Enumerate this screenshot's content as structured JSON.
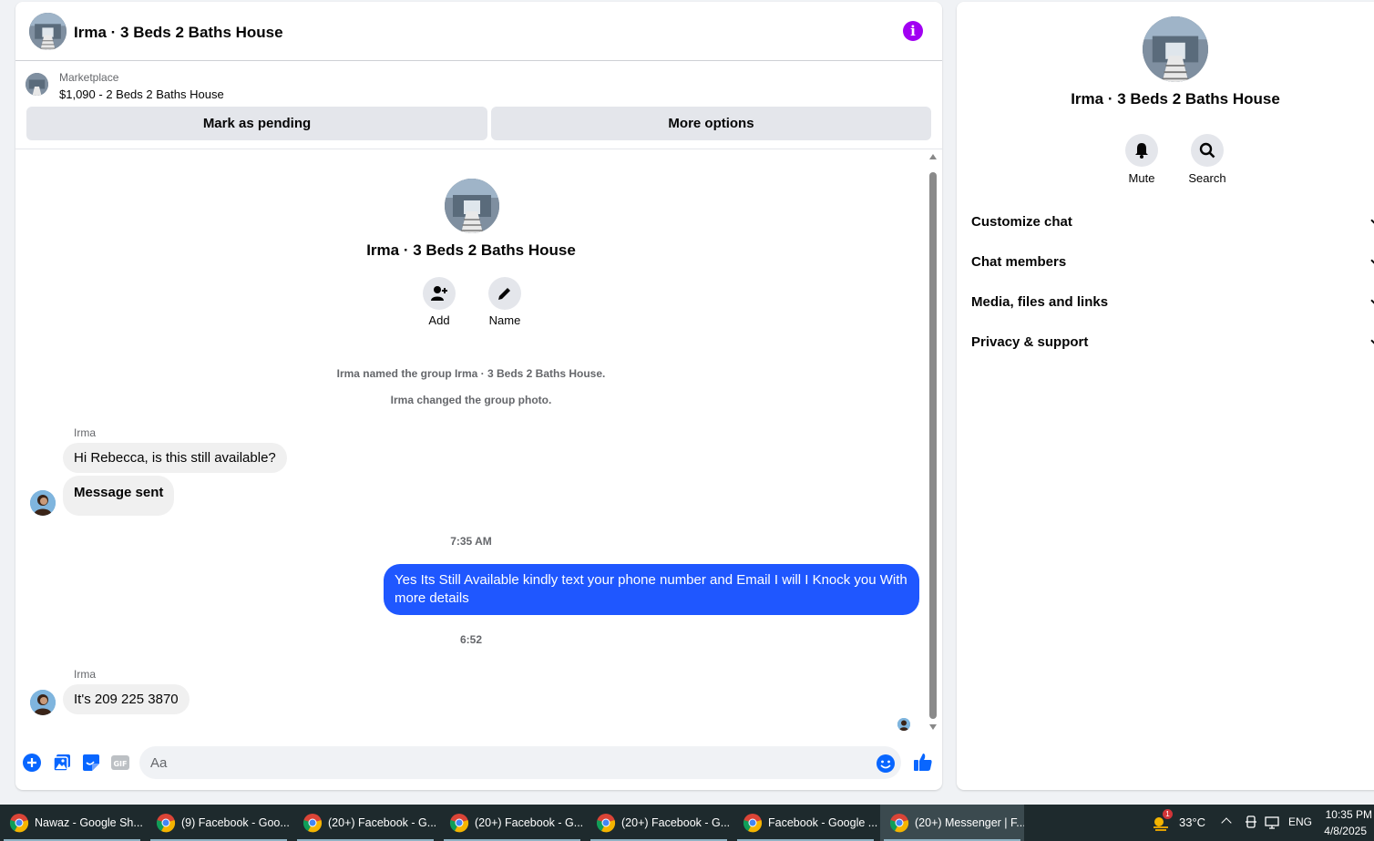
{
  "chat": {
    "title": "Irma · 3 Beds 2 Baths House",
    "marketplace_label": "Marketplace",
    "listing": "$1,090 - 2 Beds 2 Baths House",
    "mark_pending_label": "Mark as pending",
    "more_options_label": "More options",
    "group_title": "Irma · 3 Beds 2 Baths House",
    "add_label": "Add",
    "name_label": "Name",
    "system_messages": [
      "Irma named the group Irma · 3 Beds 2 Baths House.",
      "Irma changed the group photo."
    ],
    "messages": [
      {
        "sender": "Irma",
        "text": "Hi Rebecca, is this still available?"
      },
      {
        "text": "Message sent"
      },
      {
        "timestamp": "7:35 AM"
      },
      {
        "text": "Yes Its Still Available kindly text your phone number and Email I will I Knock you With more details"
      },
      {
        "timestamp": "6:52"
      },
      {
        "sender": "Irma",
        "text": "It's 209 225 3870"
      }
    ],
    "composer_placeholder": "Aa",
    "accent_color": "#1f57ff",
    "info_icon_color": "#a100f2"
  },
  "info_panel": {
    "title": "Irma · 3 Beds 2 Baths House",
    "mute_label": "Mute",
    "search_label": "Search",
    "sections": [
      "Customize chat",
      "Chat members",
      "Media, files and links",
      "Privacy & support"
    ]
  },
  "taskbar": {
    "items": [
      "Nawaz - Google Sh...",
      "(9) Facebook - Goo...",
      "(20+) Facebook - G...",
      "(20+) Facebook - G...",
      "(20+) Facebook - G...",
      "Facebook - Google ...",
      "(20+) Messenger | F..."
    ],
    "weather_badge": "1",
    "temperature": "33°C",
    "language": "ENG",
    "time": "10:35 PM",
    "date": "4/8/2025"
  }
}
